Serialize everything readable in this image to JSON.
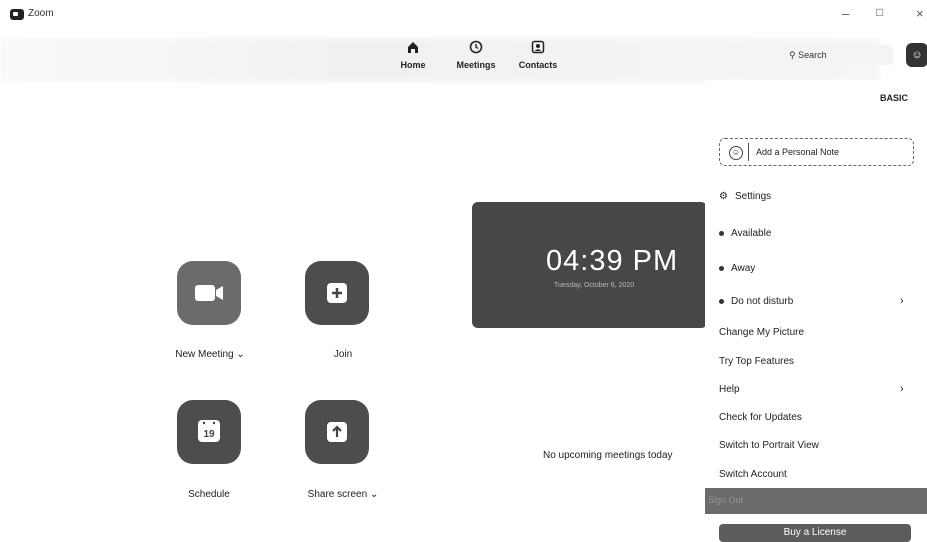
{
  "window": {
    "title": "Zoom",
    "minimize": "–",
    "maximize": "□",
    "close": "×"
  },
  "nav": [
    {
      "label": "Home",
      "icon": "home-icon"
    },
    {
      "label": "Meetings",
      "icon": "clock-icon"
    },
    {
      "label": "Contacts",
      "icon": "contacts-icon"
    }
  ],
  "search": {
    "placeholder": "Search"
  },
  "actions": {
    "new_meeting": "New Meeting",
    "new_meeting_caret": "⌄",
    "join": "Join",
    "schedule": "Schedule",
    "schedule_day": "19",
    "share_screen": "Share screen",
    "share_screen_caret": "⌄"
  },
  "clock": {
    "time": "04:39 PM",
    "date": "Tuesday, October 6, 2020"
  },
  "meetings": {
    "empty_text": "No upcoming meetings today"
  },
  "profile_menu": {
    "plan": "BASIC",
    "note_placeholder": "Add a Personal Note",
    "settings": "Settings",
    "available": "Available",
    "away": "Away",
    "do_not_disturb": "Do not disturb",
    "change_picture": "Change My Picture",
    "try_features": "Try Top Features",
    "help": "Help",
    "check_updates": "Check for Updates",
    "portrait_view": "Switch to Portrait View",
    "switch_account": "Switch Account",
    "sign_out": "Sign Out",
    "buy_license": "Buy a License"
  },
  "colors": {
    "tile_gray": "#6b6b6b",
    "tile_dark": "#4a4a4a",
    "card": "#474747"
  }
}
